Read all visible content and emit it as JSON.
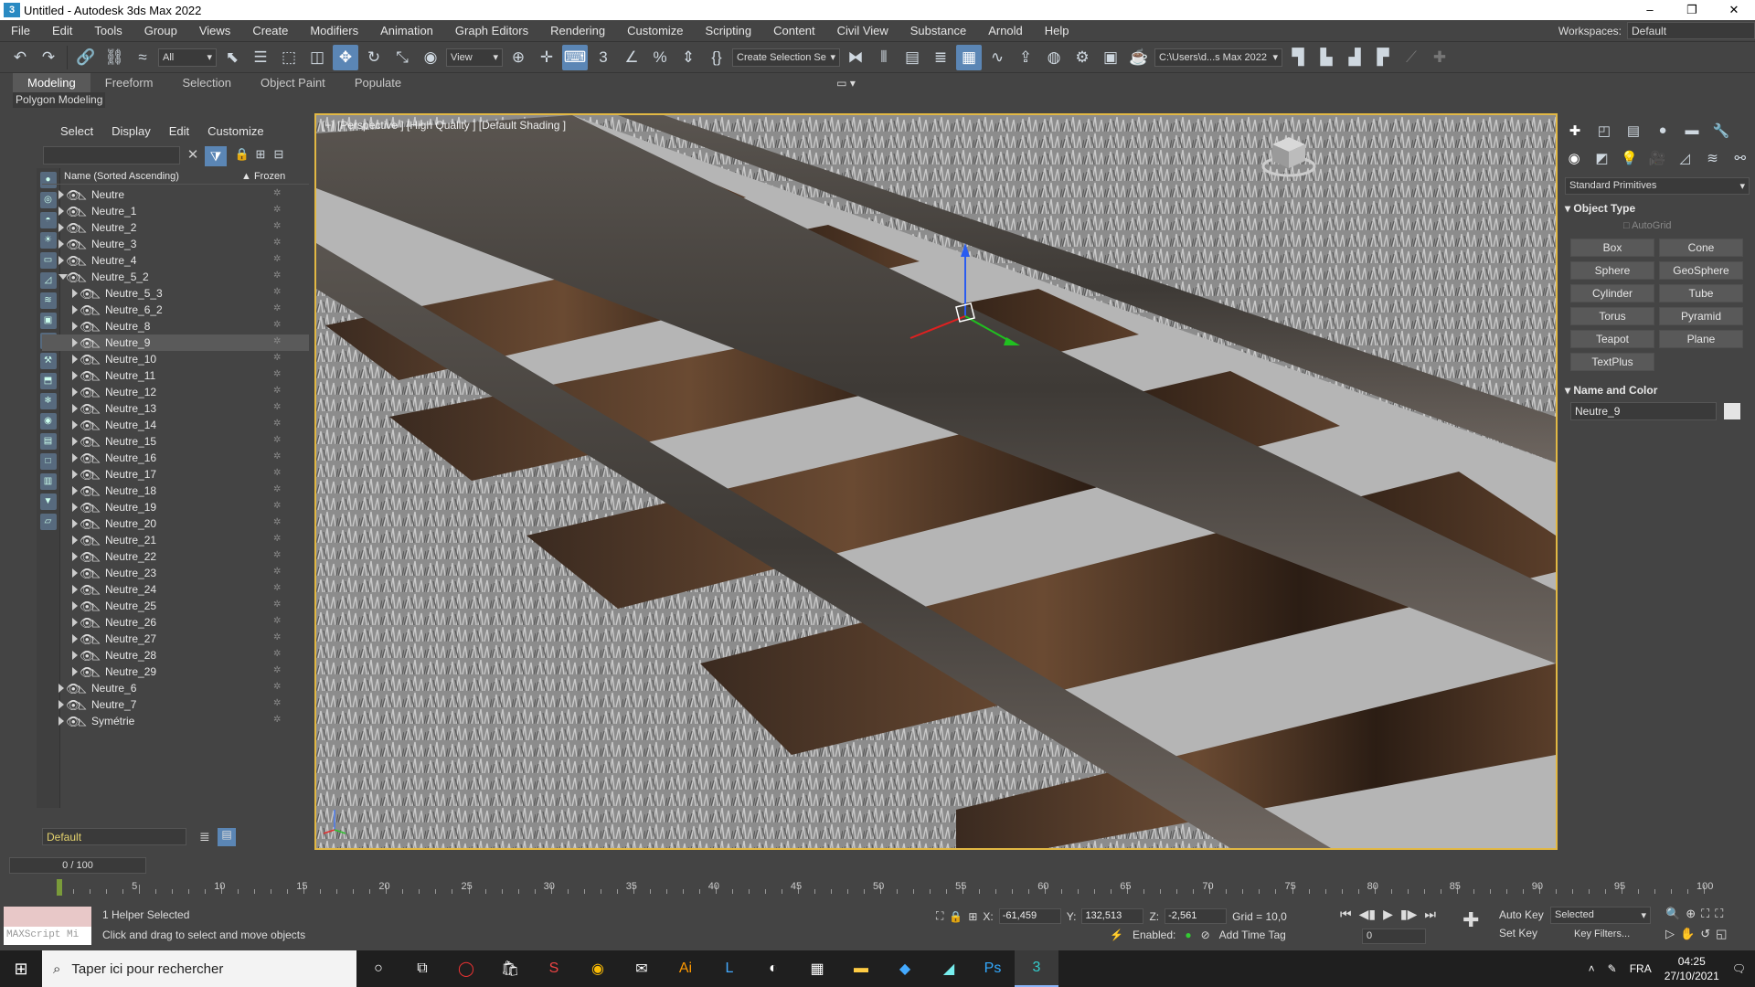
{
  "window": {
    "title": "Untitled - Autodesk 3ds Max 2022"
  },
  "menu": [
    "File",
    "Edit",
    "Tools",
    "Group",
    "Views",
    "Create",
    "Modifiers",
    "Animation",
    "Graph Editors",
    "Rendering",
    "Customize",
    "Scripting",
    "Content",
    "Civil View",
    "Substance",
    "Arnold",
    "Help"
  ],
  "workspaces": {
    "label": "Workspaces:",
    "value": "Default"
  },
  "toolbar": {
    "filter": "All",
    "refcoord": "View",
    "selection_set": "Create Selection Se",
    "project_path": "C:\\Users\\d...s Max 2022"
  },
  "ribbon": {
    "tabs": [
      "Modeling",
      "Freeform",
      "Selection",
      "Object Paint",
      "Populate"
    ],
    "active": "Modeling",
    "sub": "Polygon Modeling"
  },
  "scene_explorer": {
    "tabs": [
      "Select",
      "Display",
      "Edit",
      "Customize"
    ],
    "col_name": "Name (Sorted Ascending)",
    "col_frozen": "Frozen",
    "rows": [
      {
        "name": "Neutre",
        "indent": 0,
        "open": false
      },
      {
        "name": "Neutre_1",
        "indent": 0,
        "open": false
      },
      {
        "name": "Neutre_2",
        "indent": 0,
        "open": false
      },
      {
        "name": "Neutre_3",
        "indent": 0,
        "open": false
      },
      {
        "name": "Neutre_4",
        "indent": 0,
        "open": false
      },
      {
        "name": "Neutre_5_2",
        "indent": 0,
        "open": true
      },
      {
        "name": "Neutre_5_3",
        "indent": 1,
        "open": false
      },
      {
        "name": "Neutre_6_2",
        "indent": 1,
        "open": false
      },
      {
        "name": "Neutre_8",
        "indent": 1,
        "open": false
      },
      {
        "name": "Neutre_9",
        "indent": 1,
        "open": false,
        "selected": true
      },
      {
        "name": "Neutre_10",
        "indent": 1,
        "open": false
      },
      {
        "name": "Neutre_11",
        "indent": 1,
        "open": false
      },
      {
        "name": "Neutre_12",
        "indent": 1,
        "open": false
      },
      {
        "name": "Neutre_13",
        "indent": 1,
        "open": false
      },
      {
        "name": "Neutre_14",
        "indent": 1,
        "open": false
      },
      {
        "name": "Neutre_15",
        "indent": 1,
        "open": false
      },
      {
        "name": "Neutre_16",
        "indent": 1,
        "open": false
      },
      {
        "name": "Neutre_17",
        "indent": 1,
        "open": false
      },
      {
        "name": "Neutre_18",
        "indent": 1,
        "open": false
      },
      {
        "name": "Neutre_19",
        "indent": 1,
        "open": false
      },
      {
        "name": "Neutre_20",
        "indent": 1,
        "open": false
      },
      {
        "name": "Neutre_21",
        "indent": 1,
        "open": false
      },
      {
        "name": "Neutre_22",
        "indent": 1,
        "open": false
      },
      {
        "name": "Neutre_23",
        "indent": 1,
        "open": false
      },
      {
        "name": "Neutre_24",
        "indent": 1,
        "open": false
      },
      {
        "name": "Neutre_25",
        "indent": 1,
        "open": false
      },
      {
        "name": "Neutre_26",
        "indent": 1,
        "open": false
      },
      {
        "name": "Neutre_27",
        "indent": 1,
        "open": false
      },
      {
        "name": "Neutre_28",
        "indent": 1,
        "open": false
      },
      {
        "name": "Neutre_29",
        "indent": 1,
        "open": false
      },
      {
        "name": "Neutre_6",
        "indent": 0,
        "open": false
      },
      {
        "name": "Neutre_7",
        "indent": 0,
        "open": false
      },
      {
        "name": "Symétrie",
        "indent": 0,
        "open": false
      }
    ],
    "layer": "Default"
  },
  "viewport": {
    "label": "[+] [Perspective ] [High Quality ] [Default Shading ]"
  },
  "command_panel": {
    "category": "Standard Primitives",
    "object_type_title": "Object Type",
    "autogrid": "AutoGrid",
    "buttons": [
      "Box",
      "Cone",
      "Sphere",
      "GeoSphere",
      "Cylinder",
      "Tube",
      "Torus",
      "Pyramid",
      "Teapot",
      "Plane",
      "TextPlus"
    ],
    "name_color_title": "Name and Color",
    "object_name": "Neutre_9"
  },
  "timeline": {
    "slider": "0 / 100",
    "ticks": [
      0,
      5,
      10,
      15,
      20,
      25,
      30,
      35,
      40,
      45,
      50,
      55,
      60,
      65,
      70,
      75,
      80,
      85,
      90,
      95,
      100
    ]
  },
  "status": {
    "selected": "1 Helper Selected",
    "prompt": "Click and drag to select and move objects",
    "x": "-61,459",
    "y": "132,513",
    "z": "-2,561",
    "grid": "Grid = 10,0",
    "enabled": "Enabled:",
    "add_time_tag": "Add Time Tag",
    "auto_key": "Auto Key",
    "set_key": "Set Key",
    "selected_dd": "Selected",
    "key_filters": "Key Filters...",
    "frame": "0",
    "maxscript": "MAXScript Mi"
  },
  "taskbar": {
    "search": "Taper ici pour rechercher",
    "lang": "FRA",
    "time": "04:25",
    "date": "27/10/2021"
  }
}
